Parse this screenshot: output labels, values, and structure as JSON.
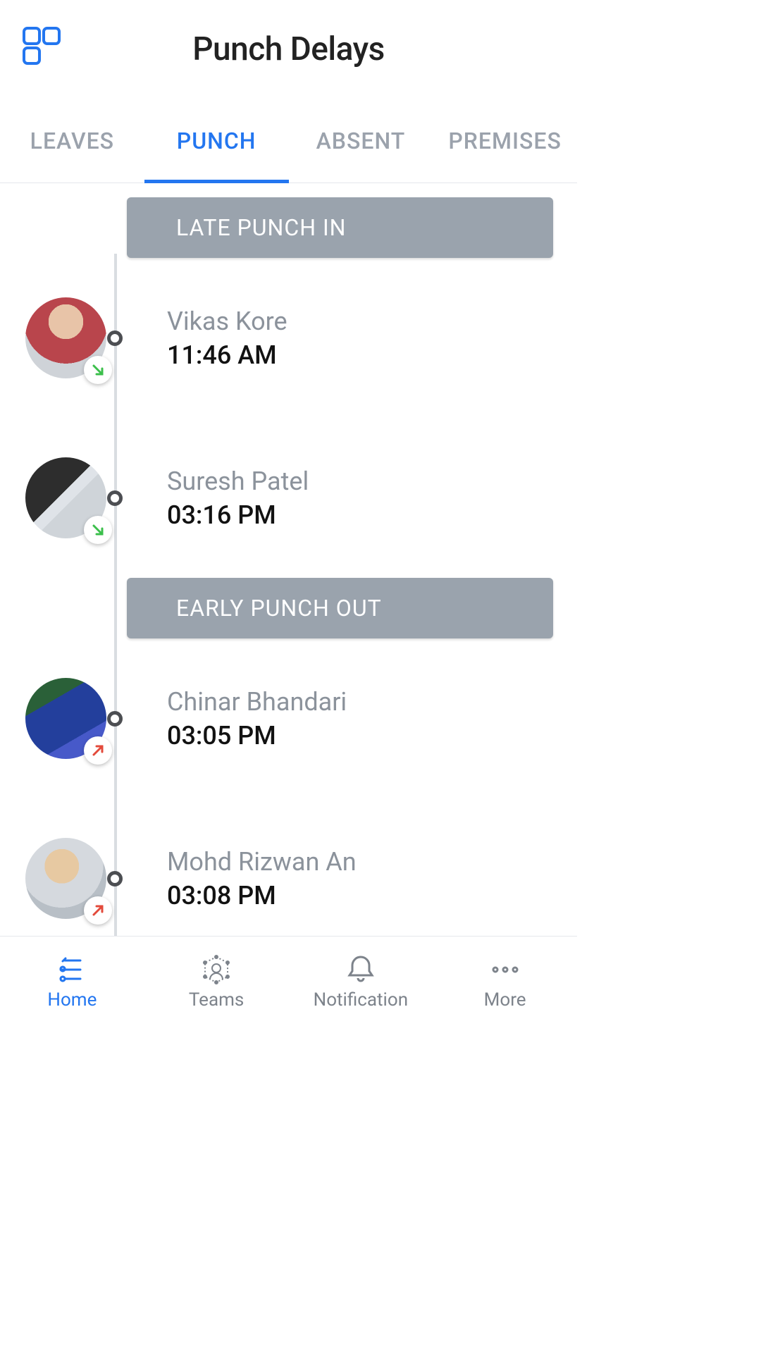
{
  "header": {
    "title": "Punch Delays"
  },
  "tabs": {
    "items": [
      {
        "label": "LEAVES"
      },
      {
        "label": "PUNCH"
      },
      {
        "label": "ABSENT"
      },
      {
        "label": "PREMISES"
      }
    ],
    "active": 1
  },
  "sections": [
    {
      "title": "LATE PUNCH IN",
      "entries": [
        {
          "name": "Vikas Kore",
          "time": "11:46 AM",
          "dir": "in"
        },
        {
          "name": "Suresh Patel",
          "time": "03:16 PM",
          "dir": "in"
        }
      ]
    },
    {
      "title": "EARLY PUNCH OUT",
      "entries": [
        {
          "name": "Chinar Bhandari",
          "time": "03:05 PM",
          "dir": "out"
        },
        {
          "name": "Mohd Rizwan An",
          "time": "03:08 PM",
          "dir": "out"
        }
      ]
    }
  ],
  "bottom_nav": {
    "items": [
      {
        "label": "Home"
      },
      {
        "label": "Teams"
      },
      {
        "label": "Notification"
      },
      {
        "label": "More"
      }
    ],
    "active": 0
  }
}
